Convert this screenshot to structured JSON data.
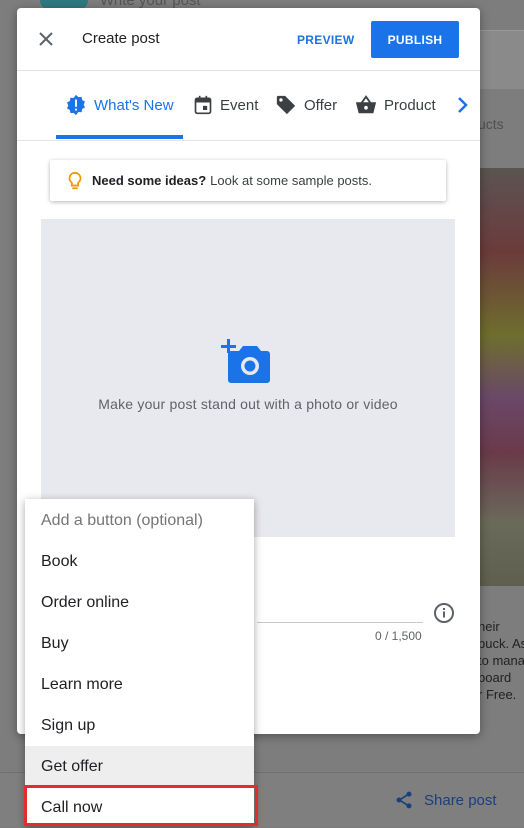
{
  "background": {
    "write_post_placeholder": "Write your post",
    "tab_partial": "ucts",
    "caption_lines": [
      "heir",
      "buck. As",
      "to mana",
      "board",
      "r Free."
    ],
    "share_label": "Share post"
  },
  "dialog": {
    "title": "Create post",
    "preview_label": "PREVIEW",
    "publish_label": "PUBLISH",
    "accent_color": "#1a73e8"
  },
  "tabs": [
    {
      "label": "What's New",
      "icon": "whats-new-icon",
      "active": true
    },
    {
      "label": "Event",
      "icon": "calendar-icon",
      "active": false
    },
    {
      "label": "Offer",
      "icon": "tag-icon",
      "active": false
    },
    {
      "label": "Product",
      "icon": "basket-icon",
      "active": false
    }
  ],
  "ideas": {
    "bold": "Need some ideas?",
    "text": "Look at some sample posts."
  },
  "photo": {
    "prompt": "Make your post stand out with a photo or video"
  },
  "description": {
    "char_count": "0 / 1,500"
  },
  "button_menu": {
    "placeholder": "Add a button (optional)",
    "options": [
      "Book",
      "Order online",
      "Buy",
      "Learn more",
      "Sign up",
      "Get offer",
      "Call now"
    ],
    "hovered": "Get offer",
    "highlighted": "Call now",
    "highlight_color": "#e32c2c"
  }
}
